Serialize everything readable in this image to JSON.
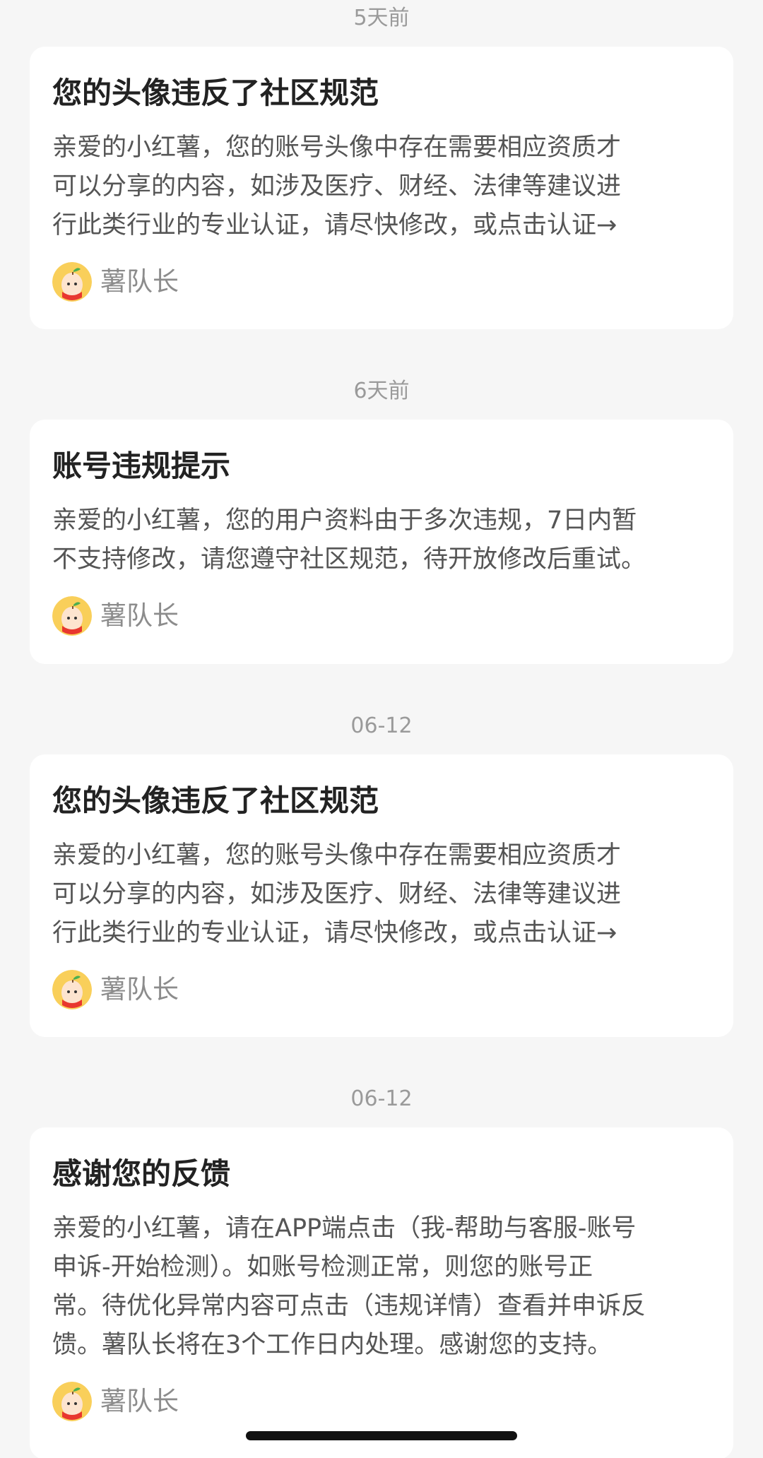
{
  "messages": [
    {
      "timestamp": "5天前",
      "title": "您的头像违反了社区规范",
      "body_lines": [
        "亲爱的小红薯，您的账号头像中存在需要相应资质才",
        "可以分享的内容，如涉及医疗、财经、法律等建议进",
        "行此类行业的专业认证，请尽快修改，或点击认证→"
      ],
      "author": "薯队长"
    },
    {
      "timestamp": "6天前",
      "title": "账号违规提示",
      "body_lines": [
        "亲爱的小红薯，您的用户资料由于多次违规，7日内暂",
        "不支持修改，请您遵守社区规范，待开放修改后重试。"
      ],
      "author": "薯队长"
    },
    {
      "timestamp": "06-12",
      "title": "您的头像违反了社区规范",
      "body_lines": [
        "亲爱的小红薯，您的账号头像中存在需要相应资质才",
        "可以分享的内容，如涉及医疗、财经、法律等建议进",
        "行此类行业的专业认证，请尽快修改，或点击认证→"
      ],
      "author": "薯队长"
    },
    {
      "timestamp": "06-12",
      "title": "感谢您的反馈",
      "body_lines": [
        "亲爱的小红薯，请在APP端点击（我-帮助与客服-账号",
        "申诉-开始检测）。如账号检测正常，则您的账号正",
        "常。待优化异常内容可点击（违规详情）查看并申诉反",
        "馈。薯队长将在3个工作日内处理。感谢您的支持。"
      ],
      "author": "薯队长"
    }
  ],
  "colors": {
    "background": "#f6f6f6",
    "card": "#ffffff",
    "title": "#222222",
    "body": "#555555",
    "meta": "#9a9a9a",
    "avatar_bg": "#f9cf5a",
    "avatar_scarf": "#e8372f"
  },
  "icons": {
    "avatar": "avatar-icon"
  }
}
